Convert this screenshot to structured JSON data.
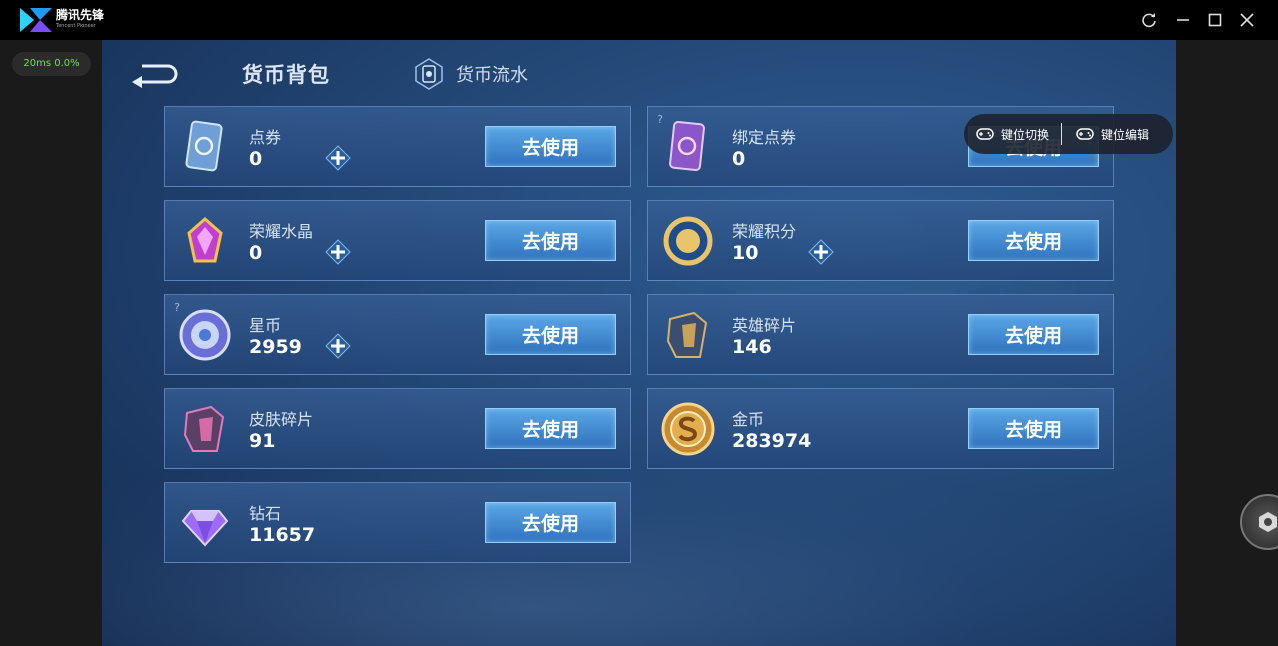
{
  "app": {
    "name": "腾讯先锋",
    "subtitle": "Tencent Pioneer",
    "fps_text": "20ms  0.0%"
  },
  "window_controls": [
    {
      "name": "refresh-icon"
    },
    {
      "name": "minimize-icon"
    },
    {
      "name": "maximize-icon"
    },
    {
      "name": "close-icon"
    }
  ],
  "header": {
    "active_tab": "货币背包",
    "flow_tab": "货币流水"
  },
  "currencies": [
    {
      "name": "点券",
      "amount": "0",
      "icon": "coupon-card-icon",
      "has_plus": true,
      "has_help": false,
      "use_label": "去使用"
    },
    {
      "name": "绑定点券",
      "amount": "0",
      "icon": "bound-coupon-card-icon",
      "has_plus": false,
      "has_help": true,
      "use_label": "去使用"
    },
    {
      "name": "荣耀水晶",
      "amount": "0",
      "icon": "glory-crystal-icon",
      "has_plus": true,
      "has_help": false,
      "use_label": "去使用"
    },
    {
      "name": "荣耀积分",
      "amount": "10",
      "icon": "glory-points-icon",
      "has_plus": true,
      "has_help": false,
      "use_label": "去使用"
    },
    {
      "name": "星币",
      "amount": "2959",
      "icon": "star-coin-icon",
      "has_plus": true,
      "has_help": true,
      "use_label": "去使用"
    },
    {
      "name": "英雄碎片",
      "amount": "146",
      "icon": "hero-fragment-icon",
      "has_plus": false,
      "has_help": false,
      "use_label": "去使用"
    },
    {
      "name": "皮肤碎片",
      "amount": "91",
      "icon": "skin-fragment-icon",
      "has_plus": false,
      "has_help": false,
      "use_label": "去使用"
    },
    {
      "name": "金币",
      "amount": "283974",
      "icon": "gold-coin-icon",
      "has_plus": false,
      "has_help": false,
      "use_label": "去使用"
    },
    {
      "name": "钻石",
      "amount": "11657",
      "icon": "diamond-icon",
      "has_plus": false,
      "has_help": false,
      "use_label": "去使用"
    }
  ],
  "overlay": {
    "key_switch": "键位切换",
    "key_edit": "键位编辑"
  },
  "colors": {
    "accent": "#3b86d4",
    "panel_border": "#7daae1",
    "fps_text": "#6ee04a"
  }
}
